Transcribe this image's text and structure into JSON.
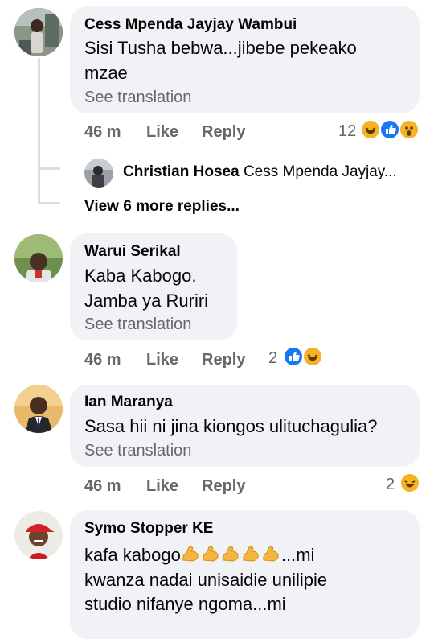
{
  "comments": [
    {
      "author": "Cess Mpenda Jayjay Wambui",
      "line1": "Sisi Tusha bebwa...jibebe pekeako",
      "line2": "mzae",
      "see_translation": "See translation",
      "time": "46 m",
      "like": "Like",
      "reply": "Reply",
      "reaction_count": "12",
      "reactions": [
        "haha",
        "like",
        "wow"
      ]
    },
    {
      "author": "Warui Serikal",
      "line1": "Kaba Kabogo.",
      "line2": "Jamba ya Ruriri",
      "see_translation": "See translation",
      "time": "46 m",
      "like": "Like",
      "reply": "Reply",
      "reaction_count": "2",
      "reactions": [
        "like",
        "haha"
      ]
    },
    {
      "author": "Ian Maranya",
      "line1": "Sasa hii ni jina kiongos ulituchagulia?",
      "see_translation": "See translation",
      "time": "46 m",
      "like": "Like",
      "reply": "Reply",
      "reaction_count": "2",
      "reactions": [
        "haha"
      ]
    },
    {
      "author": "Symo Stopper KE",
      "line1_prefix": "kafa kabogo",
      "line1_suffix": "...mi",
      "line2": "kwanza nadai unisaidie unilipie",
      "line3": "studio nifanye ngoma...mi",
      "emoji": "flexed-biceps x5"
    }
  ],
  "reply_preview": {
    "author": "Christian Hosea",
    "text": "Cess Mpenda Jayjay..."
  },
  "view_more_replies": "View 6 more replies...",
  "colors": {
    "bubble": "#f0f2f5",
    "meta_gray": "#65676b",
    "like_blue": "#1877f2",
    "haha_yellow": "#f7b125",
    "thread_line": "#dadde1"
  }
}
